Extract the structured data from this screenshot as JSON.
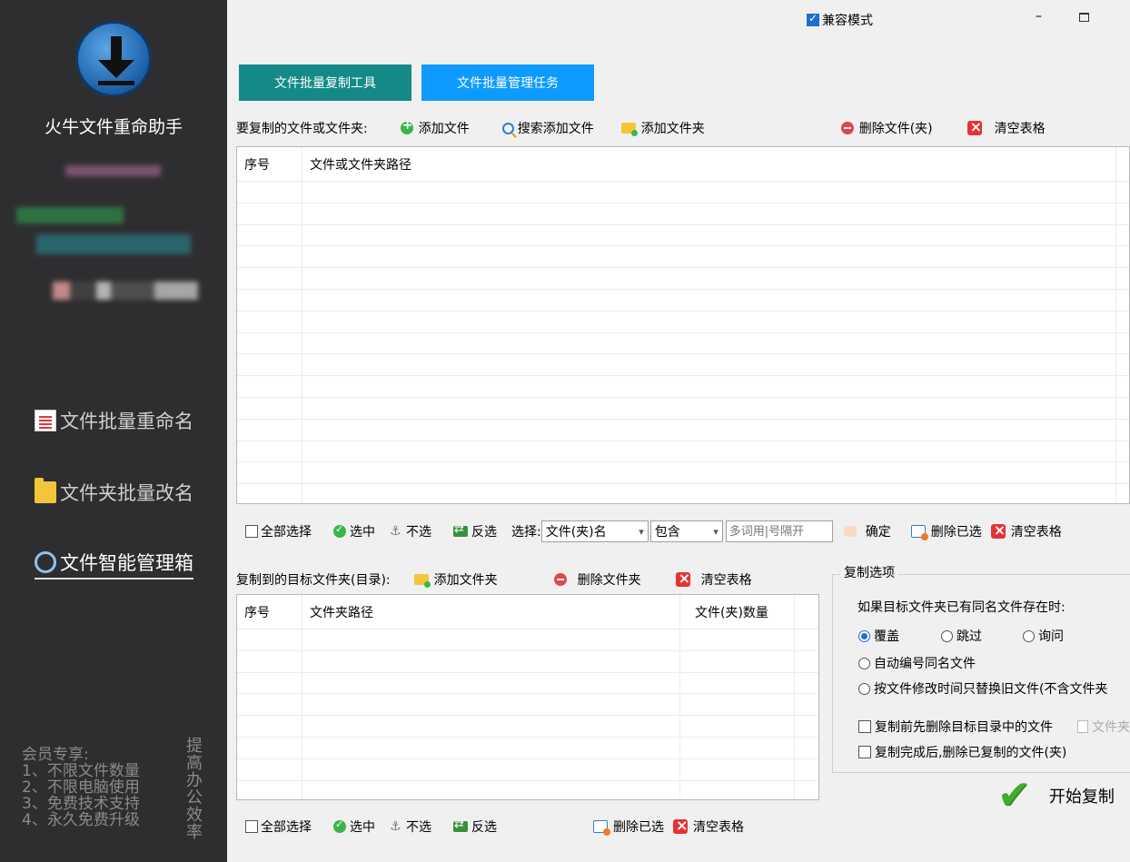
{
  "app": {
    "title": "火牛文件重命助手",
    "compat_label": "兼容模式",
    "compat_checked": true
  },
  "sidebar": {
    "items": [
      {
        "label": "文件批量重命名",
        "icon": "document-icon"
      },
      {
        "label": "文件夹批量改名",
        "icon": "folder-icon"
      },
      {
        "label": "文件智能管理箱",
        "icon": "search-icon",
        "active": true
      }
    ],
    "member": {
      "heading": "会员专享:",
      "perks": [
        "1、不限文件数量",
        "2、不限电脑使用",
        "3、免费技术支持",
        "4、永久免费升级"
      ],
      "side_text": "提高办公效率"
    }
  },
  "tabs": [
    {
      "label": "文件批量复制工具",
      "active": true
    },
    {
      "label": "文件批量管理任务",
      "active": false
    }
  ],
  "source": {
    "heading": "要复制的文件或文件夹:",
    "add_file": "添加文件",
    "search_add": "搜索添加文件",
    "add_folder": "添加文件夹",
    "delete": "删除文件(夹)",
    "clear": "清空表格",
    "columns": [
      "序号",
      "文件或文件夹路径"
    ],
    "rows": []
  },
  "filter": {
    "select_all": "全部选择",
    "select": "选中",
    "deselect": "不选",
    "invert": "反选",
    "choose_label": "选择:",
    "field_value": "文件(夹)名",
    "match_value": "包含",
    "keyword_placeholder": "多词用|号隔开",
    "confirm": "确定",
    "delete_selected": "删除已选",
    "clear": "清空表格"
  },
  "target": {
    "heading": "复制到的目标文件夹(目录):",
    "add_folder": "添加文件夹",
    "delete_folder": "删除文件夹",
    "clear": "清空表格",
    "columns": [
      "序号",
      "文件夹路径",
      "文件(夹)数量"
    ],
    "rows": []
  },
  "bottom": {
    "select_all": "全部选择",
    "select": "选中",
    "deselect": "不选",
    "invert": "反选",
    "delete_selected": "删除已选",
    "clear": "清空表格"
  },
  "options": {
    "legend": "复制选项",
    "same_name_label": "如果目标文件夹已有同名文件存在时:",
    "overwrite": "覆盖",
    "skip": "跳过",
    "ask": "询问",
    "auto_number": "自动编号同名文件",
    "replace_by_time": "按文件修改时间只替换旧文件(不含文件夹",
    "pre_delete": "复制前先删除目标目录中的文件",
    "folder_option": "文件夹",
    "post_delete": "复制完成后,删除已复制的文件(夹)",
    "selected_mode": "overwrite"
  },
  "start_label": "开始复制"
}
